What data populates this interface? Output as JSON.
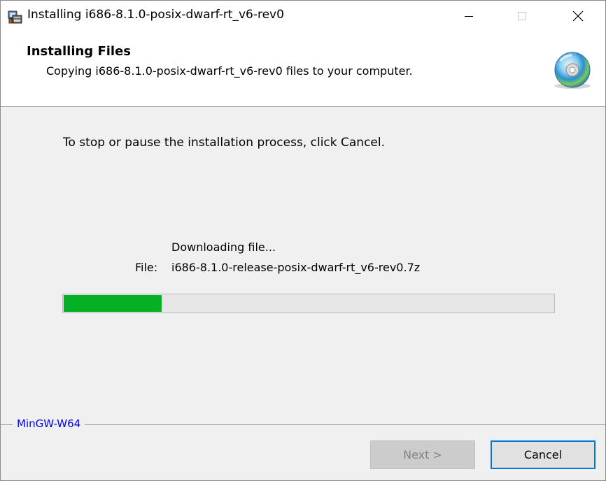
{
  "window": {
    "title": "Installing i686-8.1.0-posix-dwarf-rt_v6-rev0",
    "app_icon": "installer-icon",
    "controls": {
      "minimize": "minimize-icon",
      "maximize": "maximize-icon",
      "close": "close-icon"
    }
  },
  "header": {
    "title": "Installing Files",
    "subtitle": "Copying i686-8.1.0-posix-dwarf-rt_v6-rev0 files to your computer.",
    "icon": "cd-icon"
  },
  "body": {
    "instruction": "To stop or pause the installation process, click Cancel.",
    "status": "Downloading file...",
    "file_label": "File:",
    "file_name": "i686-8.1.0-release-posix-dwarf-rt_v6-rev0.7z",
    "progress": {
      "fraction": 0.2,
      "color": "#06b025"
    }
  },
  "footer": {
    "brand": "MinGW-W64",
    "brand_color": "#0000ff",
    "next_label": "Next >",
    "next_enabled": false,
    "cancel_label": "Cancel",
    "focus_color": "#0078d7"
  }
}
